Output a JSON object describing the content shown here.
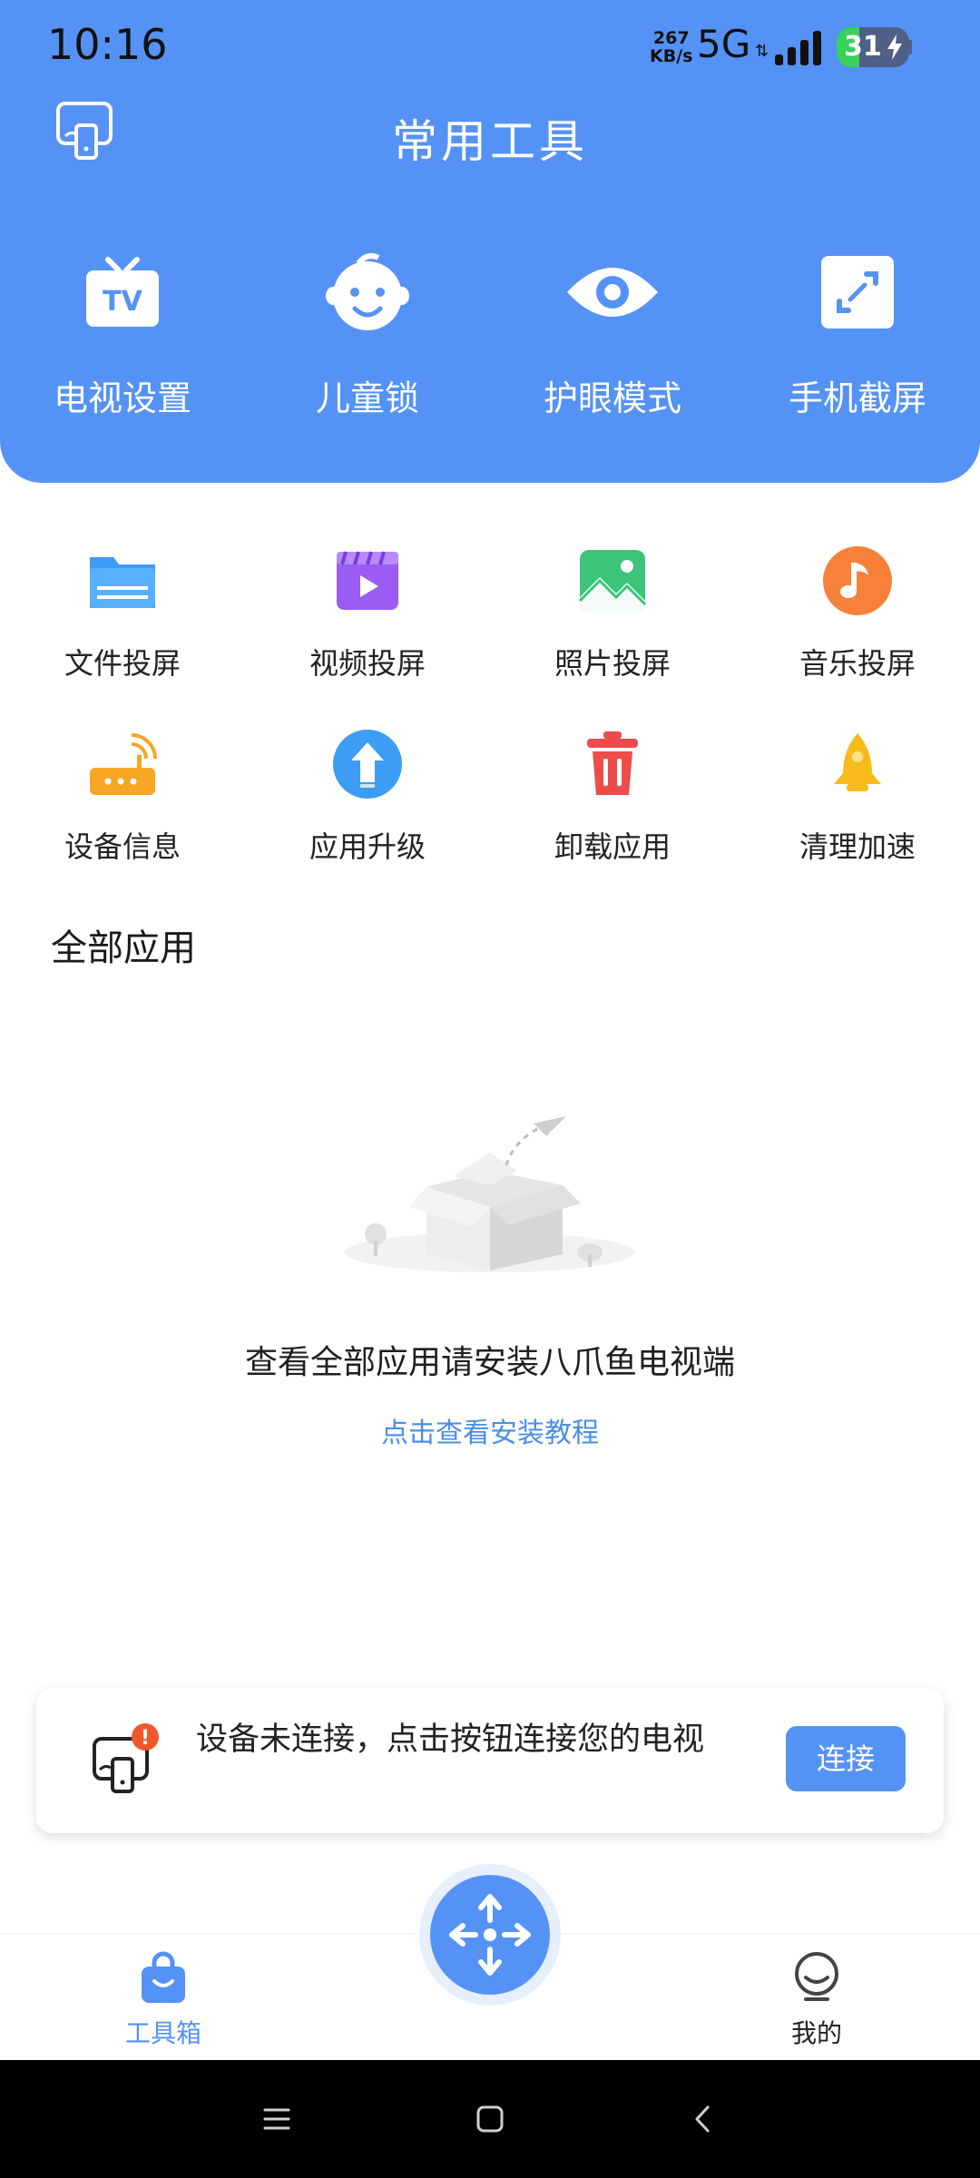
{
  "status_bar": {
    "time": "10:16",
    "net_speed_value": "267",
    "net_speed_unit": "KB/s",
    "network": "5G",
    "battery": "31",
    "battery_level": 0.31
  },
  "header": {
    "title": "常用工具",
    "cast_icon": "cast-device-icon"
  },
  "top_tools": [
    {
      "label": "电视设置",
      "icon": "tv-icon"
    },
    {
      "label": "儿童锁",
      "icon": "child-face-icon"
    },
    {
      "label": "护眼模式",
      "icon": "eye-icon"
    },
    {
      "label": "手机截屏",
      "icon": "screenshot-icon"
    }
  ],
  "grid_tools": [
    {
      "label": "文件投屏",
      "icon": "folder-icon"
    },
    {
      "label": "视频投屏",
      "icon": "video-icon"
    },
    {
      "label": "照片投屏",
      "icon": "photo-icon"
    },
    {
      "label": "音乐投屏",
      "icon": "music-icon"
    },
    {
      "label": "设备信息",
      "icon": "router-icon"
    },
    {
      "label": "应用升级",
      "icon": "upgrade-icon"
    },
    {
      "label": "卸载应用",
      "icon": "trash-icon"
    },
    {
      "label": "清理加速",
      "icon": "rocket-icon"
    }
  ],
  "all_apps": {
    "title": "全部应用",
    "empty_message": "查看全部应用请安装八爪鱼电视端",
    "tutorial_link": "点击查看安装教程"
  },
  "connect_card": {
    "message": "设备未连接，点击按钮连接您的电视",
    "button": "连接",
    "alert_badge": "!"
  },
  "bottom_nav": {
    "toolbox": "工具箱",
    "mine": "我的"
  },
  "colors": {
    "primary": "#5592f5",
    "link": "#4a8ee6",
    "alert": "#f0582b"
  }
}
